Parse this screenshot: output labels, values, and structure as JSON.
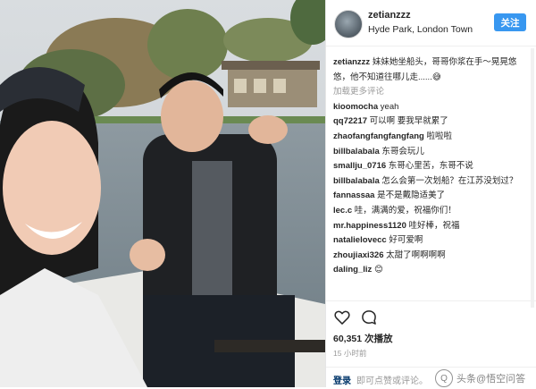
{
  "post": {
    "username": "zetianzzz",
    "location": "Hyde Park, London Town",
    "follow_label": "关注",
    "caption_user": "zetianzzz",
    "caption_text": "妹妹她坐船头，哥哥你浆在手～晃晃悠悠，他不知道往哪儿走......😅",
    "load_more": "加载更多评论",
    "likes": "60,351 次播放",
    "time_ago": "15 小时前",
    "login_label": "登录",
    "login_hint": "即可点赞或评论。",
    "watermark": "头条@悟空问答"
  },
  "comments": [
    {
      "user": "kioomocha",
      "text": "yeah"
    },
    {
      "user": "qq72217",
      "text": "可以啊 要我早就累了"
    },
    {
      "user": "zhaofangfangfangfang",
      "text": "啦啦啦"
    },
    {
      "user": "billbalabala",
      "text": "东哥会玩儿"
    },
    {
      "user": "smallju_0716",
      "text": "东哥心里苦，东哥不说"
    },
    {
      "user": "billbalabala",
      "text": "怎么会第一次划船？在江苏没划过？"
    },
    {
      "user": "fannassaa",
      "text": "是不是戴隐适美了"
    },
    {
      "user": "lec.c",
      "text": "哇，满满的爱，祝福你们！"
    },
    {
      "user": "mr.happiness1120",
      "text": "哇好棒，祝福"
    },
    {
      "user": "natalielovecc",
      "text": "好可爱啊"
    },
    {
      "user": "zhoujiaxi326",
      "text": "太甜了啊啊啊啊"
    },
    {
      "user": "daling_liz",
      "text": "😊"
    }
  ],
  "icons": {
    "heart": "heart-icon",
    "comment": "comment-icon"
  }
}
